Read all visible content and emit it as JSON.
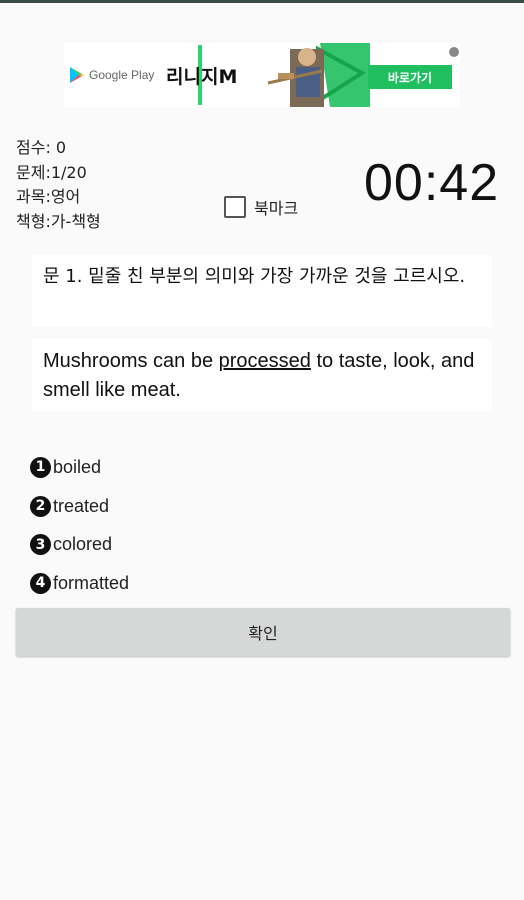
{
  "ad": {
    "store_label": "Google Play",
    "game_title": "리니지M",
    "cta_label": "바로가기",
    "accent_color": "#1fbf5f"
  },
  "info": {
    "score": "점수: 0",
    "question": "문제:1/20",
    "subject": "과목:영어",
    "booklet": "책형:가-책형"
  },
  "bookmark": {
    "label": "북마크",
    "checked": false
  },
  "timer": "00:42",
  "question": {
    "prompt": "문 1. 밑줄 친 부분의 의미와 가장 가까운 것을 고르시오.",
    "sentence_before": "Mushrooms can be ",
    "sentence_underlined": "processed",
    "sentence_after": " to taste, look, and smell like meat."
  },
  "choices": [
    {
      "num": "1",
      "text": "boiled"
    },
    {
      "num": "2",
      "text": "treated"
    },
    {
      "num": "3",
      "text": "colored"
    },
    {
      "num": "4",
      "text": "formatted"
    }
  ],
  "confirm_label": "확인"
}
